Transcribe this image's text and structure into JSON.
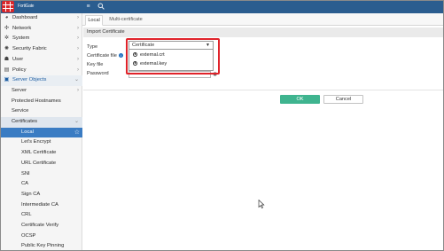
{
  "app": {
    "title": "FortiGate"
  },
  "header": {
    "menu_icon": "hamburger-icon",
    "search_icon": "search-icon"
  },
  "sidebar": {
    "items": [
      {
        "label": "Dashboard",
        "icon": "dashboard-icon"
      },
      {
        "label": "Network",
        "icon": "network-icon"
      },
      {
        "label": "System",
        "icon": "gear-icon"
      },
      {
        "label": "Security Fabric",
        "icon": "fabric-icon"
      },
      {
        "label": "User",
        "icon": "user-icon"
      },
      {
        "label": "Policy",
        "icon": "policy-icon"
      },
      {
        "label": "Server Objects",
        "icon": "server-icon"
      },
      {
        "label": "Server"
      },
      {
        "label": "Protected Hostnames"
      },
      {
        "label": "Service"
      },
      {
        "label": "Certificates"
      },
      {
        "label": "Local"
      },
      {
        "label": "Let's Encrypt"
      },
      {
        "label": "XML Certificate"
      },
      {
        "label": "URL Certificate"
      },
      {
        "label": "SNI"
      },
      {
        "label": "CA"
      },
      {
        "label": "Sign CA"
      },
      {
        "label": "Intermediate CA"
      },
      {
        "label": "CRL"
      },
      {
        "label": "Certificate Verify"
      },
      {
        "label": "OCSP"
      },
      {
        "label": "Public Key Pinning"
      }
    ]
  },
  "tabs": [
    {
      "label": "Local"
    },
    {
      "label": "Multi-certificate"
    }
  ],
  "section_title": "Import Certificate",
  "form": {
    "type_label": "Type",
    "type_value": "Certificate",
    "certificate_file_label": "Certificate file",
    "key_file_label": "Key file",
    "password_label": "Password",
    "options": [
      "external.crt",
      "external.key"
    ]
  },
  "buttons": {
    "ok": "OK",
    "cancel": "Cancel"
  },
  "colors": {
    "topbar": "#2b5d8f",
    "accent": "#3a7cc3",
    "ok": "#3fb48f",
    "highlight": "#e0232a"
  }
}
